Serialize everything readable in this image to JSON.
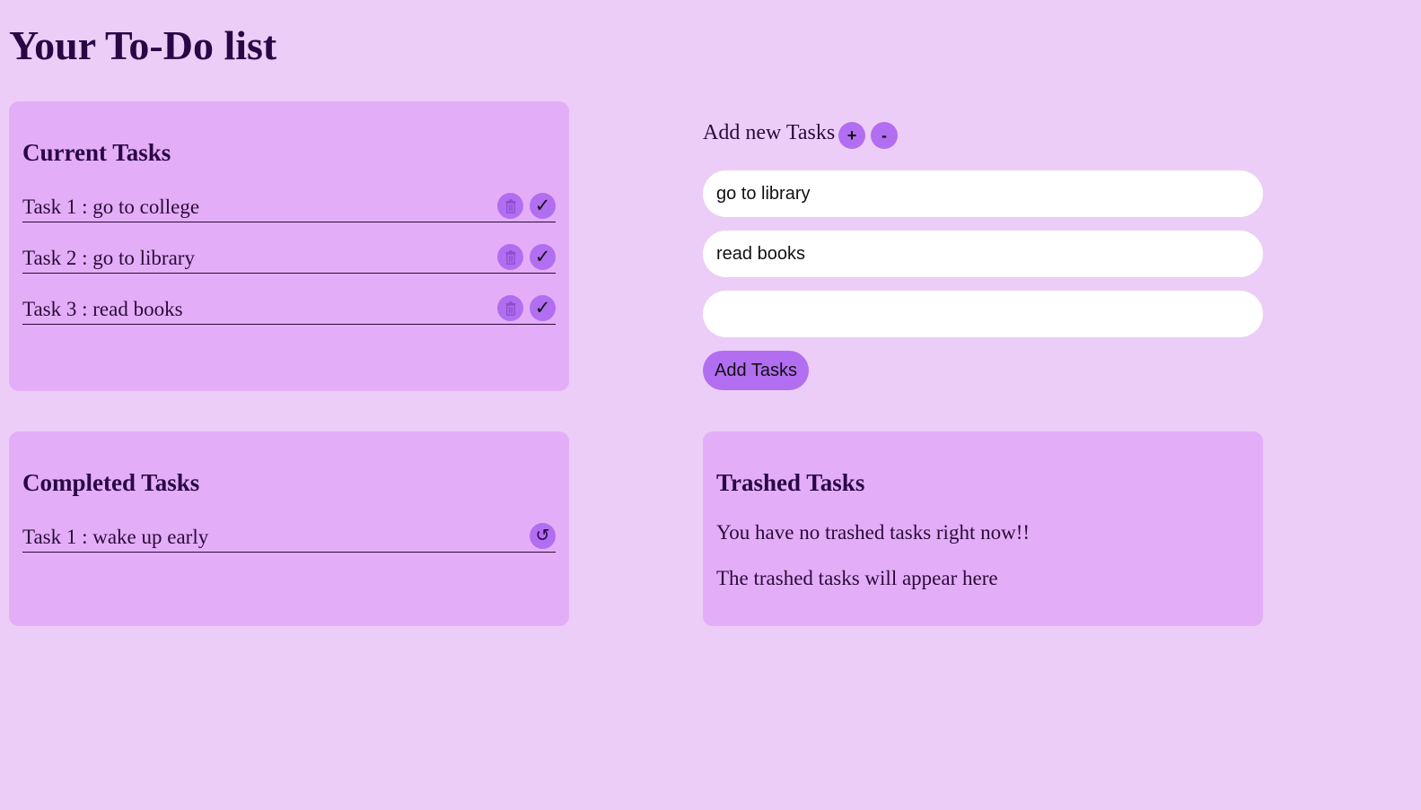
{
  "page": {
    "title": "Your To-Do list"
  },
  "current": {
    "heading": "Current Tasks",
    "tasks": [
      {
        "label": "Task 1 : go to college"
      },
      {
        "label": "Task 2 : go to library"
      },
      {
        "label": "Task 3 : read books"
      }
    ]
  },
  "add": {
    "label": "Add new Tasks",
    "plus_label": "+",
    "minus_label": "-",
    "inputs": [
      {
        "value": "go to library"
      },
      {
        "value": "read books"
      },
      {
        "value": ""
      }
    ],
    "submit_label": "Add Tasks"
  },
  "completed": {
    "heading": "Completed Tasks",
    "tasks": [
      {
        "label": "Task 1 : wake up early"
      }
    ]
  },
  "trashed": {
    "heading": "Trashed Tasks",
    "empty_message": "You have no trashed tasks right now!!",
    "hint_message": "The trashed tasks will appear here"
  },
  "icons": {
    "trash": "trash-icon",
    "check": "check-icon",
    "undo": "undo-icon"
  },
  "colors": {
    "background": "#eccdf7",
    "card": "#e3aef7",
    "accent": "#b26ef0",
    "text": "#2a0645"
  }
}
